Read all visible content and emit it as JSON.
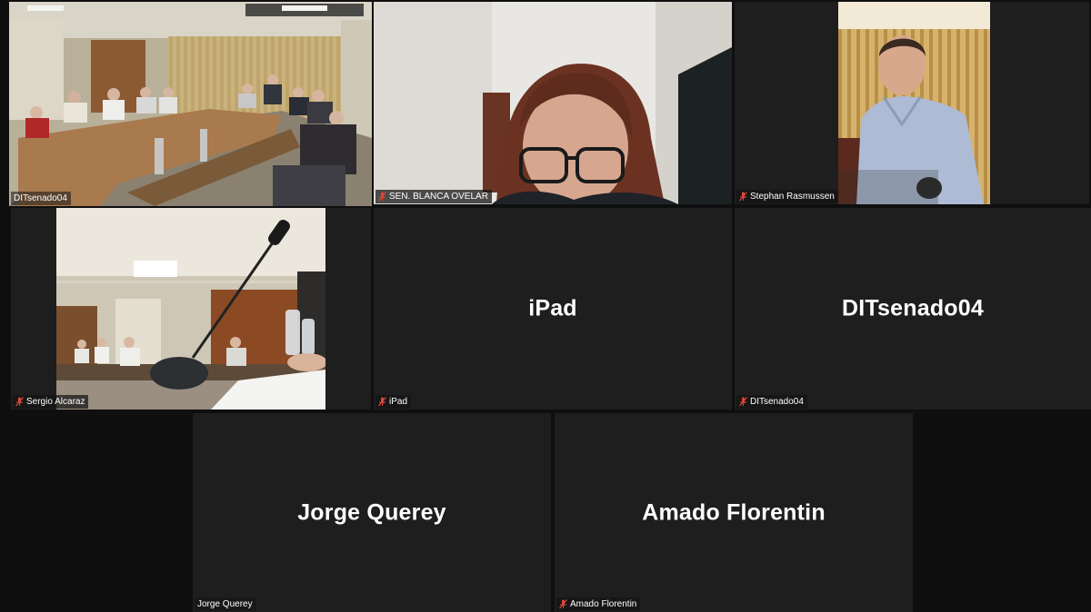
{
  "participants": [
    {
      "id": "t1",
      "name": "DITsenado04",
      "video": true,
      "muted": false,
      "active": true
    },
    {
      "id": "t2",
      "name": "SEN. BLANCA OVELAR",
      "video": true,
      "muted": true
    },
    {
      "id": "t3",
      "name": "Stephan Rasmussen",
      "video": true,
      "muted": true
    },
    {
      "id": "t4",
      "name": "Sergio Alcaraz",
      "video": true,
      "muted": true
    },
    {
      "id": "t5",
      "name": "iPad",
      "center_name": "iPad",
      "video": false,
      "muted": true
    },
    {
      "id": "t6",
      "name": "DITsenado04",
      "center_name": "DITsenado04",
      "video": false,
      "muted": true
    },
    {
      "id": "t7",
      "name": "Jorge Querey",
      "center_name": "Jorge Querey",
      "video": false,
      "muted": false
    },
    {
      "id": "t8",
      "name": "Amado Florentin",
      "center_name": "Amado Florentin",
      "video": false,
      "muted": true
    }
  ],
  "colors": {
    "tile_bg": "#1e1e1e",
    "active_speaker_border": "#d6e34a",
    "muted_mic": "#e0463a"
  },
  "icons": {
    "muted": "mic-muted-icon"
  }
}
